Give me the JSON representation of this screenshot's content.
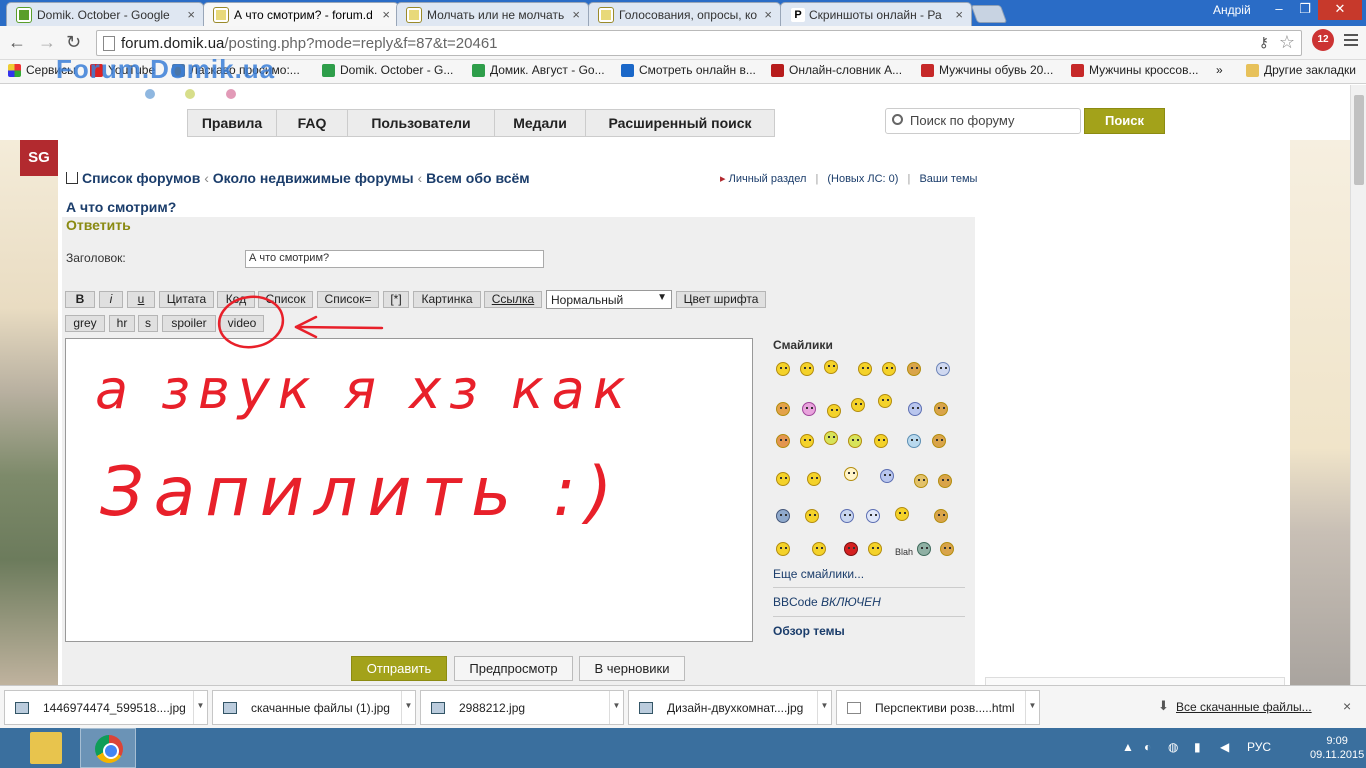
{
  "browser": {
    "tabs": [
      {
        "label": "Domik. October - Google"
      },
      {
        "label": "А что смотрим? - forum.d"
      },
      {
        "label": "Молчать или не молчать"
      },
      {
        "label": "Голосования, опросы, ко"
      },
      {
        "label": "Скриншоты онлайн - Ра"
      }
    ],
    "user": "Андрій",
    "url_host": "forum.domik.ua",
    "url_path": "/posting.php?mode=reply&f=87&t=20461",
    "ext_badge": "12"
  },
  "bookmarks": {
    "items": [
      "Сервисы",
      "YouTube",
      "Ласкаво просимо:...",
      "Domik. October - G...",
      "Домик. Август - Go...",
      "Смотреть онлайн в...",
      "Онлайн-словник А...",
      "Мужчины обувь 20...",
      "Мужчины кроссов..."
    ],
    "more": "»",
    "other": "Другие закладки",
    "overlay_logo": "Forum.Domik.ua"
  },
  "forum": {
    "nav": [
      "Правила",
      "FAQ",
      "Пользователи",
      "Медали",
      "Расширенный поиск"
    ],
    "search_placeholder": "Поиск по форуму",
    "search_button": "Поиск",
    "sg_logo": "SG",
    "breadcrumbs": [
      "Список форумов",
      "Около недвижимые форумы",
      "Всем обо всём"
    ],
    "crumb_sep": "‹",
    "personal": "Личный раздел",
    "new_pm": "(Новых ЛС: 0)",
    "your_topics": "Ваши темы",
    "topic_title": "А что смотрим?",
    "reply_label": "Ответить",
    "subject_label": "Заголовок:",
    "subject_value": "А что смотрим?",
    "bbcode_row1": [
      "B",
      "i",
      "u",
      "Цитата",
      "Код",
      "Список",
      "Список=",
      "[*]",
      "Картинка",
      "Ссылка"
    ],
    "font_size": "Нормальный",
    "font_color": "Цвет шрифта",
    "bbcode_row2": [
      "grey",
      "hr",
      "s",
      "spoiler",
      "video"
    ],
    "smilies_title": "Смайлики",
    "smilies_more": "Еще смайлики...",
    "bbcode_status_prefix": "BBCode",
    "bbcode_status": "ВКЛЮЧЕН",
    "topic_review": "Обзор темы",
    "submit": "Отправить",
    "preview": "Предпросмотр",
    "drafts": "В черновики",
    "handwriting_line1": "а звук я хз как",
    "handwriting_line2": "Запилить :)",
    "blah_label": "Blah"
  },
  "downloads": {
    "items": [
      "1446974474_599518....jpg",
      "скачанные файлы (1).jpg",
      "2988212.jpg",
      "Дизайн-двухкомнат....jpg",
      "Перспективи розв.....html"
    ],
    "all": "Все скачанные файлы...",
    "close": "×"
  },
  "taskbar": {
    "lang": "РУС",
    "time": "9:09",
    "date": "09.11.2015"
  },
  "colors": {
    "accent_olive": "#a3a21a",
    "link_blue": "#1b3d6b",
    "annotation_red": "#e8202a",
    "tabbar": "#2a6cc6"
  }
}
